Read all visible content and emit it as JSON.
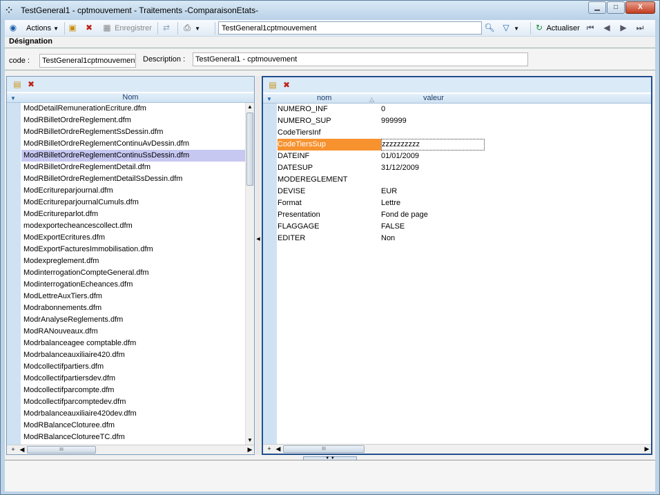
{
  "window": {
    "title": "TestGeneral1 - cptmouvement -  Traitements -ComparaisonEtats-",
    "buttons": {
      "minimize": "▁",
      "maximize": "□",
      "close": "X"
    }
  },
  "toolbar": {
    "actions_label": "Actions",
    "save_label": "Enregistrer",
    "search_value": "TestGeneral1cptmouvement",
    "refresh_label": "Actualiser"
  },
  "header": {
    "section_title": "Désignation",
    "code_label": "code :",
    "code_value": "TestGeneral1cptmouvement",
    "description_label": "Description :",
    "description_value": "TestGeneral1 - cptmouvement"
  },
  "left_pane": {
    "column_header": "Nom",
    "items": [
      "ModDetailRemunerationEcriture.dfm",
      "ModRBilletOrdreReglement.dfm",
      "ModRBilletOrdreReglementSsDessin.dfm",
      "ModRBilletOrdreReglementContinuAvDessin.dfm",
      "ModRBilletOrdreReglementContinuSsDessin.dfm",
      "ModRBilletOrdreReglementDetail.dfm",
      "ModRBilletOrdreReglementDetailSsDessin.dfm",
      "ModEcritureparjournal.dfm",
      "ModEcritureparjournalCumuls.dfm",
      "ModEcritureparlot.dfm",
      "modexportecheancescollect.dfm",
      "ModExportEcritures.dfm",
      "ModExportFacturesImmobilisation.dfm",
      "Modexpreglement.dfm",
      "ModinterrogationCompteGeneral.dfm",
      "ModinterrogationEcheances.dfm",
      "ModLettreAuxTiers.dfm",
      "Modrabonnements.dfm",
      "ModrAnalyseReglements.dfm",
      "ModRANouveaux.dfm",
      "Modrbalanceagee comptable.dfm",
      "Modrbalanceauxiliaire420.dfm",
      "Modcollectifpartiers.dfm",
      "Modcollectifpartiersdev.dfm",
      "Modcollectifparcompte.dfm",
      "Modcollectifparcomptedev.dfm",
      "Modrbalanceauxiliaire420dev.dfm",
      "ModRBalanceCloturee.dfm",
      "ModRBalanceClotureeTC.dfm"
    ],
    "selected_index": 4
  },
  "right_pane": {
    "col_name": "nom",
    "col_value": "valeur",
    "rows": [
      {
        "k": "NUMERO_INF",
        "v": "0"
      },
      {
        "k": "NUMERO_SUP",
        "v": "999999"
      },
      {
        "k": "CodeTiersInf",
        "v": ""
      },
      {
        "k": "CodeTiersSup",
        "v": "zzzzzzzzzz"
      },
      {
        "k": "DATEINF",
        "v": "01/01/2009"
      },
      {
        "k": "DATESUP",
        "v": "31/12/2009"
      },
      {
        "k": "MODEREGLEMENT",
        "v": ""
      },
      {
        "k": "DEVISE",
        "v": "EUR"
      },
      {
        "k": "Format",
        "v": "Lettre"
      },
      {
        "k": "Presentation",
        "v": "Fond de page"
      },
      {
        "k": "FLAGGAGE",
        "v": "FALSE"
      },
      {
        "k": "EDITER",
        "v": "Non"
      }
    ],
    "selected_index": 3
  },
  "colors": {
    "selection_list": "#c7c8f2",
    "selection_prop": "#f7922f",
    "accent_border": "#1f4e8c"
  }
}
